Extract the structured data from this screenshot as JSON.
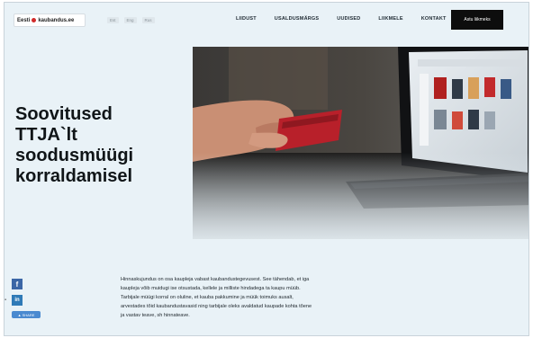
{
  "header": {
    "logo_text": "Eesti",
    "logo_text_2": "kaubandus.ee",
    "languages": [
      "Est",
      "Eng",
      "Rus"
    ],
    "nav": [
      "LIIDUST",
      "USALDUSMÄRGS",
      "UUDISED",
      "LIIKMELE",
      "KONTAKT"
    ],
    "cta_label": "Astu liikmeks"
  },
  "hero": {
    "title": "Soovitused TTJA`lt soodusmüügi korraldamisel"
  },
  "social": {
    "facebook": "f",
    "linkedin": "in",
    "share_label": "SHARE"
  },
  "article": {
    "lines": [
      "Hinnaskujundus on osa kaupleja vabast kaubandustegevusest. See tähendab, et iga",
      "kaupleja võib muidugi ise otsustada, kellele ja milliste hindadega ta kaupu müüb.",
      "Tarbijale müügi korral on oluline, et kauba pakkumine ja müük toimuks ausalt,",
      "arvestades tõid kaubandustavasid ning tarbijale oleks avaldatud kaupade kohta tõene",
      "ja vastav teave, sh hinnateave."
    ]
  },
  "colors": {
    "page_bg": "#e9f2f7",
    "cta_bg": "#0d0d0d",
    "title": "#101518",
    "facebook": "#3b66a6",
    "linkedin": "#2f7ab7"
  }
}
